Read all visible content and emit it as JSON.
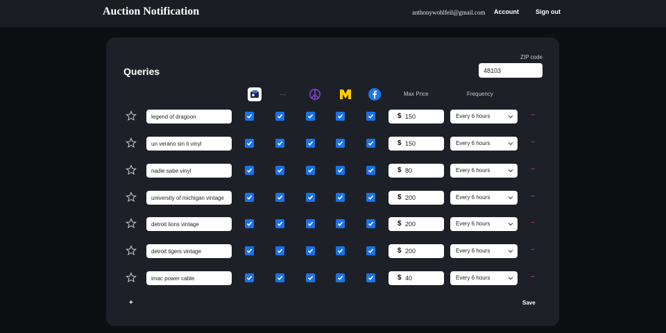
{
  "header": {
    "brand": "Auction Notification",
    "email": "anthonywohlfeil@gmail.com",
    "account_label": "Account",
    "signout_label": "Sign out"
  },
  "queries": {
    "title": "Queries",
    "zip_label": "ZIP code",
    "zip_value": "48103",
    "columns": {
      "dots_label": "···",
      "max_price": "Max Price",
      "frequency": "Frequency"
    },
    "source_icons": [
      "app-store-icon",
      "more-dots-icon",
      "peace-sign-icon",
      "michigan-m-icon",
      "facebook-icon"
    ],
    "currency_symbol": "$",
    "remove_label": "–",
    "add_label": "+",
    "save_label": "Save",
    "rows": [
      {
        "query": "legend of dragoon",
        "checks": [
          true,
          true,
          true,
          true,
          true
        ],
        "price": "150",
        "frequency": "Every 6 hours"
      },
      {
        "query": "un verano sin ti vinyl",
        "checks": [
          true,
          true,
          true,
          true,
          true
        ],
        "price": "150",
        "frequency": "Every 6 hours"
      },
      {
        "query": "nadie sabe vinyl",
        "checks": [
          true,
          true,
          true,
          true,
          true
        ],
        "price": "80",
        "frequency": "Every 6 hours"
      },
      {
        "query": "university of michigan vintage",
        "checks": [
          true,
          true,
          true,
          true,
          true
        ],
        "price": "200",
        "frequency": "Every 6 hours"
      },
      {
        "query": "detroit lions vintage",
        "checks": [
          true,
          true,
          true,
          true,
          true
        ],
        "price": "200",
        "frequency": "Every 6 hours"
      },
      {
        "query": "detroit tigers vintage",
        "checks": [
          true,
          true,
          true,
          true,
          true
        ],
        "price": "200",
        "frequency": "Every 6 hours"
      },
      {
        "query": "imac power cable",
        "checks": [
          true,
          true,
          true,
          true,
          true
        ],
        "price": "40",
        "frequency": "Every 6 hours"
      }
    ]
  },
  "colors": {
    "page_bg": "#0e0f12",
    "header_bg": "#1b1d22",
    "card_bg": "#1e2027",
    "checkbox": "#1a73e8",
    "remove": "#d64545",
    "peace": "#7b3fbf",
    "michigan_m": "#ffcb05",
    "facebook": "#1877f2"
  }
}
